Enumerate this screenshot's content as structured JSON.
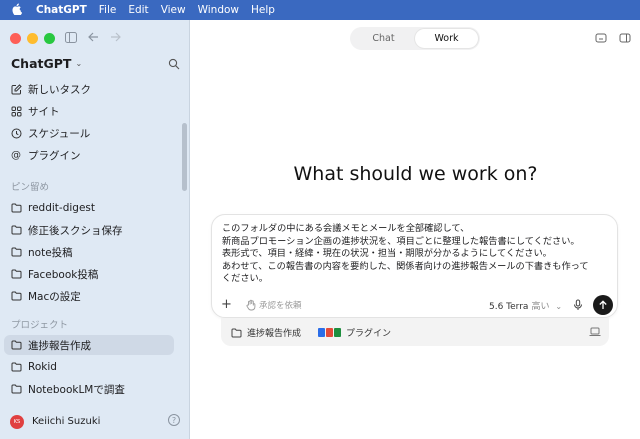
{
  "menubar": {
    "app": "ChatGPT",
    "items": [
      "File",
      "Edit",
      "View",
      "Window",
      "Help"
    ]
  },
  "sidebar": {
    "title": "ChatGPT",
    "nav": [
      {
        "label": "新しいタスク",
        "icon": "compose-icon"
      },
      {
        "label": "サイト",
        "icon": "sites-icon"
      },
      {
        "label": "スケジュール",
        "icon": "clock-icon"
      },
      {
        "label": "プラグイン",
        "icon": "at-icon"
      }
    ],
    "pinned_header": "ピン留め",
    "pinned": [
      "reddit-digest",
      "修正後スクショ保存",
      "note投稿",
      "Facebook投稿",
      "Macの設定"
    ],
    "projects_header": "プロジェクト",
    "projects": [
      "進捗報告作成",
      "Rokid",
      "NotebookLMで調査"
    ],
    "active_project_index": 0,
    "user": {
      "name": "Keiichi Suzuki",
      "initials": "KS"
    }
  },
  "main": {
    "tabs": [
      "Chat",
      "Work"
    ],
    "active_tab": "Work",
    "headline": "What should we work on?",
    "composer": {
      "lines": [
        "このフォルダの中にある会議メモとメールを全部確認して、",
        "新商品プロモーション企画の進捗状況を、項目ごとに整理した報告書にしてください。",
        "表形式で、項目・経緯・現在の状況・担当・期限が分かるようにしてください。",
        "あわせて、この報告書の内容を要約した、関係者向けの進捗報告メールの下書きも作って",
        "ください。"
      ],
      "approval": "承認を依頼",
      "model": "5.6 Terra",
      "level": "高い"
    },
    "tray": {
      "folder": "進捗報告作成",
      "plugins": "プラグイン"
    }
  },
  "colors": {
    "menubar": "#3a69c0",
    "sidebar": "#dfe9f4",
    "send": "#1a1a1a"
  }
}
